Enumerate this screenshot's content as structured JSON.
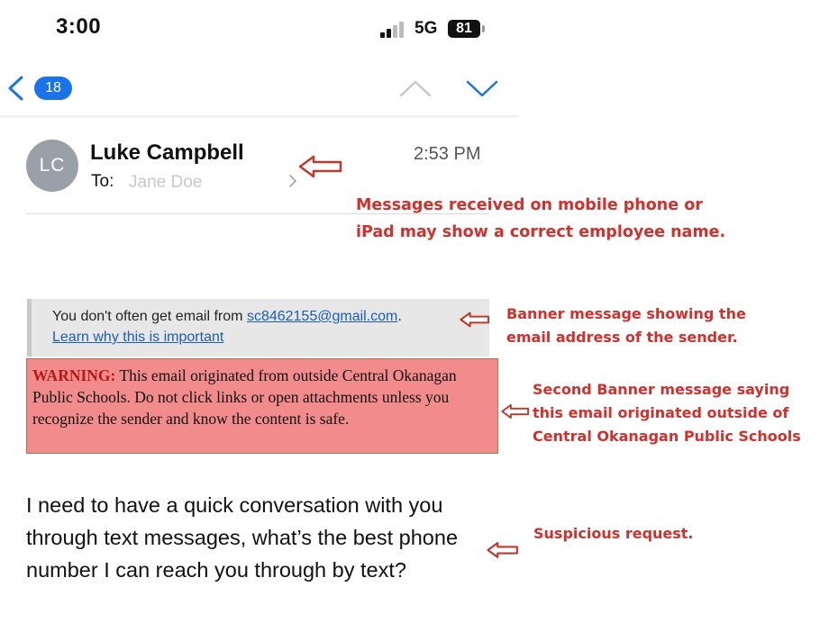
{
  "status_bar": {
    "time": "3:00",
    "network": "5G",
    "battery": "81"
  },
  "nav": {
    "unread_count": "18"
  },
  "message": {
    "avatar_initials": "LC",
    "sender": "Luke Campbell",
    "to_label": "To:",
    "recipient": "Jane Doe",
    "time": "2:53 PM",
    "banner1": {
      "prefix": "You don't often get email from ",
      "email": "sc8462155@gmail.com",
      "suffix": ".",
      "learn_link": "Learn why this is important"
    },
    "banner2": {
      "label": "WARNING:",
      "text": " This email originated from outside Central Okanagan Public Schools. Do not click links or open attachments unless you recognize the sender and know the content is safe."
    },
    "body": "I need to have a quick conversation with you through text messages, what’s the best phone number I can reach you through by text?"
  },
  "annotations": {
    "mobile_name": "Messages received on mobile phone or iPad may show a correct employee name.",
    "banner_email": "Banner message showing the email address of the sender.",
    "banner_outside": "Second Banner message saying this email originated outside of Central Okanagan Public Schools",
    "suspicious": "Suspicious request."
  },
  "colors": {
    "annotation": "#d0312d",
    "warning_bg": "#f28c8c",
    "accent": "#1a73e8"
  }
}
